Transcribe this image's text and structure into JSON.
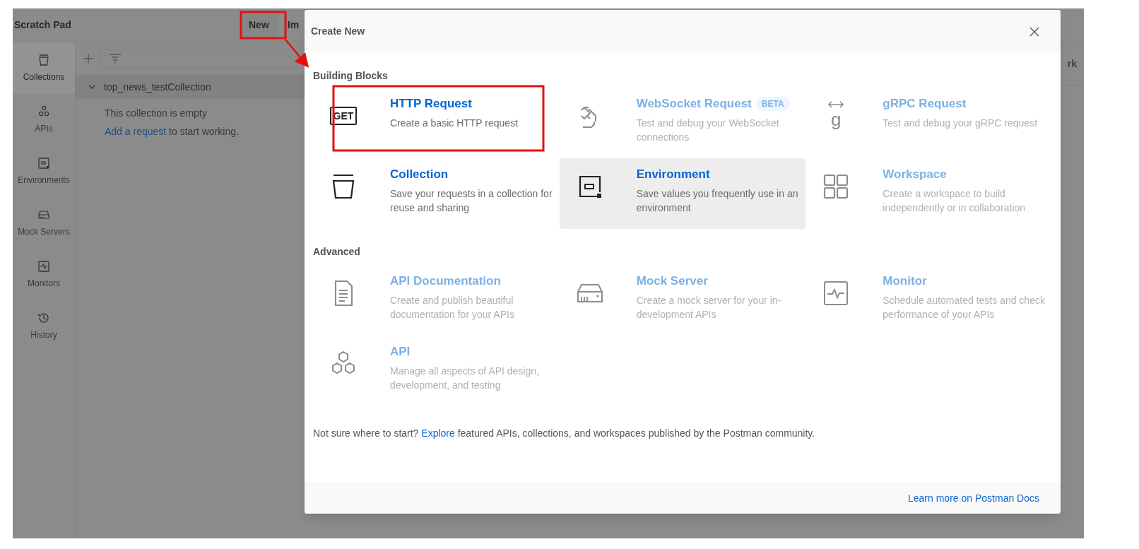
{
  "topbar": {
    "title": "Scratch Pad",
    "buttons": [
      "New",
      "Im"
    ]
  },
  "sidebar": {
    "items": [
      {
        "label": "Collections",
        "selected": true
      },
      {
        "label": "APIs",
        "selected": false
      },
      {
        "label": "Environments",
        "selected": false
      },
      {
        "label": "Mock Servers",
        "selected": false
      },
      {
        "label": "Monitors",
        "selected": false
      },
      {
        "label": "History",
        "selected": false
      }
    ]
  },
  "collections": [
    {
      "name": "top_news_testCollection",
      "expanded": true,
      "empty_message": "This collection is empty",
      "hint": {
        "link": "Add a request",
        "rest": "to start working."
      }
    }
  ],
  "background_button": "rk",
  "modal": {
    "title": "Create New",
    "sections": [
      {
        "label": "Building Blocks",
        "items": [
          {
            "title": "HTTP Request",
            "description": "Create a basic HTTP request",
            "enabled": true,
            "highlighted": false,
            "icon_text": "GET"
          },
          {
            "title": "WebSocket Request",
            "badge": "BETA",
            "description": "Test and debug your WebSocket connections",
            "enabled": false,
            "highlighted": false
          },
          {
            "title": "gRPC Request",
            "description": "Test and debug your gRPC request",
            "enabled": false,
            "highlighted": false,
            "icon_text": "g"
          },
          {
            "title": "Collection",
            "description": "Save your requests in a collection for reuse and sharing",
            "enabled": true,
            "highlighted": false
          },
          {
            "title": "Environment",
            "description": "Save values you frequently use in an environment",
            "enabled": true,
            "highlighted": true
          },
          {
            "title": "Workspace",
            "description": "Create a workspace to build independently or in collaboration",
            "enabled": false,
            "highlighted": false
          }
        ]
      },
      {
        "label": "Advanced",
        "items": [
          {
            "title": "API Documentation",
            "description": "Create and publish beautiful documentation for your APIs",
            "enabled": false,
            "highlighted": false
          },
          {
            "title": "Mock Server",
            "description": "Create a mock server for your in-development APIs",
            "enabled": false,
            "highlighted": false
          },
          {
            "title": "Monitor",
            "description": "Schedule automated tests and check performance of your APIs",
            "enabled": false,
            "highlighted": false
          },
          {
            "title": "API",
            "description": "Manage all aspects of API design, development, and testing",
            "enabled": false,
            "highlighted": false
          }
        ]
      }
    ],
    "footer_text": {
      "before": "Not sure where to start?",
      "link": "Explore",
      "after": "featured APIs, collections, and workspaces published by the Postman community."
    },
    "footer_link": "Learn more on Postman Docs"
  }
}
